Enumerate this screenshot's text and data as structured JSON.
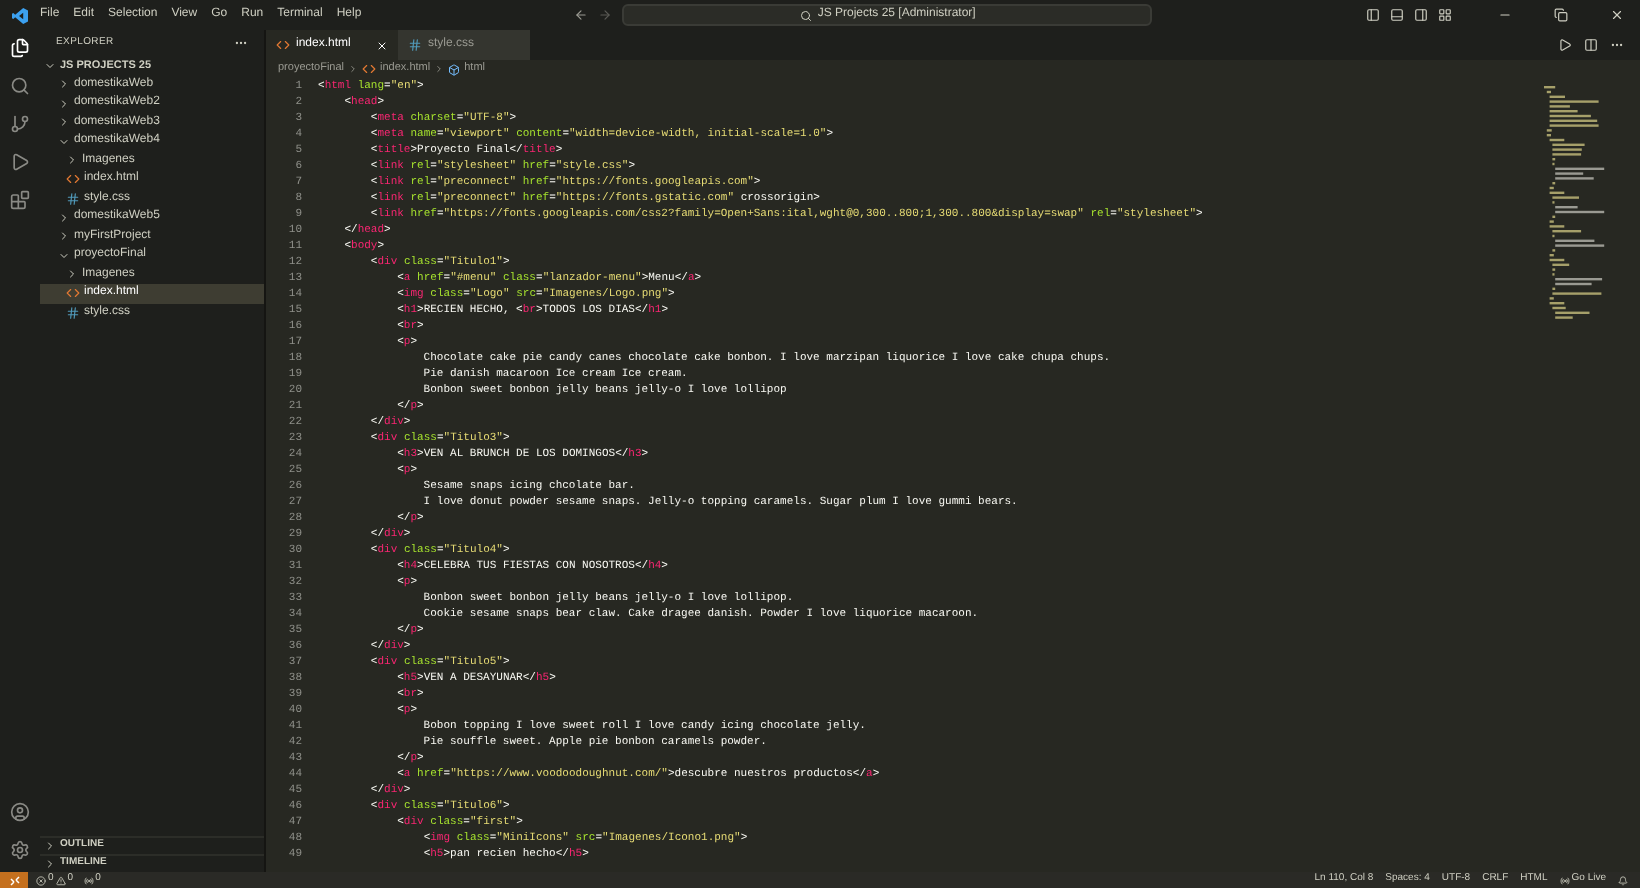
{
  "menu": [
    "File",
    "Edit",
    "Selection",
    "View",
    "Go",
    "Run",
    "Terminal",
    "Help"
  ],
  "command_center": {
    "text": "JS Projects 25 [Administrator]"
  },
  "explorer": {
    "title": "EXPLORER",
    "root": {
      "label": "JS PROJECTS 25",
      "expanded": true
    },
    "items": [
      {
        "label": "domestikaWeb",
        "kind": "folder",
        "expanded": false,
        "selected": false
      },
      {
        "label": "domestikaWeb2",
        "kind": "folder",
        "expanded": false,
        "selected": false
      },
      {
        "label": "domestikaWeb3",
        "kind": "folder",
        "expanded": false,
        "selected": false
      },
      {
        "label": "domestikaWeb4",
        "kind": "folder",
        "expanded": true,
        "selected": false,
        "children": [
          {
            "label": "Imagenes",
            "kind": "folder",
            "expanded": false,
            "selected": false
          },
          {
            "label": "index.html",
            "kind": "html",
            "selected": false
          },
          {
            "label": "style.css",
            "kind": "css",
            "selected": false
          }
        ]
      },
      {
        "label": "domestikaWeb5",
        "kind": "folder",
        "expanded": false,
        "selected": false
      },
      {
        "label": "myFirstProject",
        "kind": "folder",
        "expanded": false,
        "selected": false
      },
      {
        "label": "proyectoFinal",
        "kind": "folder",
        "expanded": true,
        "selected": false,
        "children": [
          {
            "label": "Imagenes",
            "kind": "folder",
            "expanded": false,
            "selected": false
          },
          {
            "label": "index.html",
            "kind": "html",
            "selected": true
          },
          {
            "label": "style.css",
            "kind": "css",
            "selected": false
          }
        ]
      }
    ]
  },
  "sidebar_sections": [
    {
      "label": "OUTLINE",
      "expanded": false
    },
    {
      "label": "TIMELINE",
      "expanded": false
    }
  ],
  "tabs": [
    {
      "label": "index.html",
      "kind": "html",
      "selected": true
    },
    {
      "label": "style.css",
      "kind": "css",
      "selected": false
    }
  ],
  "breadcrumbs": [
    "proyectoFinal",
    "index.html",
    "html"
  ],
  "code": [
    {
      "number": "1",
      "text": "<html lang=\"en\">"
    },
    {
      "number": "2",
      "text": "    <head>"
    },
    {
      "number": "3",
      "text": "        <meta charset=\"UTF-8\">"
    },
    {
      "number": "4",
      "text": "        <meta name=\"viewport\" content=\"width=device-width, initial-scale=1.0\">"
    },
    {
      "number": "5",
      "text": "        <title>Proyecto Final</title>"
    },
    {
      "number": "6",
      "text": "        <link rel=\"stylesheet\" href=\"style.css\">"
    },
    {
      "number": "7",
      "text": "        <link rel=\"preconnect\" href=\"https://fonts.googleapis.com\">"
    },
    {
      "number": "8",
      "text": "        <link rel=\"preconnect\" href=\"https://fonts.gstatic.com\" crossorigin>"
    },
    {
      "number": "9",
      "text": "        <link href=\"https://fonts.googleapis.com/css2?family=Open+Sans:ital,wght@0,300..800;1,300..800&display=swap\" rel=\"stylesheet\">"
    },
    {
      "number": "10",
      "text": "    </head>"
    },
    {
      "number": "11",
      "text": "    <body>"
    },
    {
      "number": "12",
      "text": "        <div class=\"Titulo1\">"
    },
    {
      "number": "13",
      "text": "            <a href=\"#menu\" class=\"lanzador-menu\">Menu</a>"
    },
    {
      "number": "14",
      "text": "            <img class=\"Logo\" src=\"Imagenes/Logo.png\">"
    },
    {
      "number": "15",
      "text": "            <h1>RECIEN HECHO, <br>TODOS LOS DIAS</h1>"
    },
    {
      "number": "16",
      "text": "            <br>"
    },
    {
      "number": "17",
      "text": "            <p>"
    },
    {
      "number": "18",
      "text": "                Chocolate cake pie candy canes chocolate cake bonbon. I love marzipan liquorice I love cake chupa chups."
    },
    {
      "number": "19",
      "text": "                Pie danish macaroon Ice cream Ice cream."
    },
    {
      "number": "20",
      "text": "                Bonbon sweet bonbon jelly beans jelly-o I love lollipop"
    },
    {
      "number": "21",
      "text": "            </p>"
    },
    {
      "number": "22",
      "text": "        </div>"
    },
    {
      "number": "23",
      "text": "        <div class=\"Titulo3\">"
    },
    {
      "number": "24",
      "text": "            <h3>VEN AL BRUNCH DE LOS DOMINGOS</h3>"
    },
    {
      "number": "25",
      "text": "            <p>"
    },
    {
      "number": "26",
      "text": "                Sesame snaps icing chcolate bar."
    },
    {
      "number": "27",
      "text": "                I love donut powder sesame snaps. Jelly-o topping caramels. Sugar plum I love gummi bears."
    },
    {
      "number": "28",
      "text": "            </p>"
    },
    {
      "number": "29",
      "text": "        </div>"
    },
    {
      "number": "30",
      "text": "        <div class=\"Titulo4\">"
    },
    {
      "number": "31",
      "text": "            <h4>CELEBRA TUS FIESTAS CON NOSOTROS</h4>"
    },
    {
      "number": "32",
      "text": "            <p>"
    },
    {
      "number": "33",
      "text": "                Bonbon sweet bonbon jelly beans jelly-o I love lollipop."
    },
    {
      "number": "34",
      "text": "                Cookie sesame snaps bear claw. Cake dragee danish. Powder I love liquorice macaroon."
    },
    {
      "number": "35",
      "text": "            </p>"
    },
    {
      "number": "36",
      "text": "        </div>"
    },
    {
      "number": "37",
      "text": "        <div class=\"Titulo5\">"
    },
    {
      "number": "38",
      "text": "            <h5>VEN A DESAYUNAR</h5>"
    },
    {
      "number": "39",
      "text": "            <br>"
    },
    {
      "number": "40",
      "text": "            <p>"
    },
    {
      "number": "41",
      "text": "                Bobon topping I love sweet roll I love candy icing chocolate jelly."
    },
    {
      "number": "42",
      "text": "                Pie souffle sweet. Apple pie bonbon caramels powder."
    },
    {
      "number": "43",
      "text": "            </p>"
    },
    {
      "number": "44",
      "text": "            <a href=\"https://www.voodoodoughnut.com/\">descubre nuestros productos</a>"
    },
    {
      "number": "45",
      "text": "        </div>"
    },
    {
      "number": "46",
      "text": "        <div class=\"Titulo6\">"
    },
    {
      "number": "47",
      "text": "            <div class=\"first\">"
    },
    {
      "number": "48",
      "text": "                <img class=\"MiniIcons\" src=\"Imagenes/Icono1.png\">"
    },
    {
      "number": "49",
      "text": "                <h5>pan recien hecho</h5>"
    }
  ],
  "status_bar": {
    "errors": "0",
    "warnings": "0",
    "ports": "0",
    "items": [
      "Ln 110, Col 8",
      "Spaces: 4",
      "UTF-8",
      "CRLF",
      "HTML"
    ],
    "go_live": "Go Live"
  }
}
